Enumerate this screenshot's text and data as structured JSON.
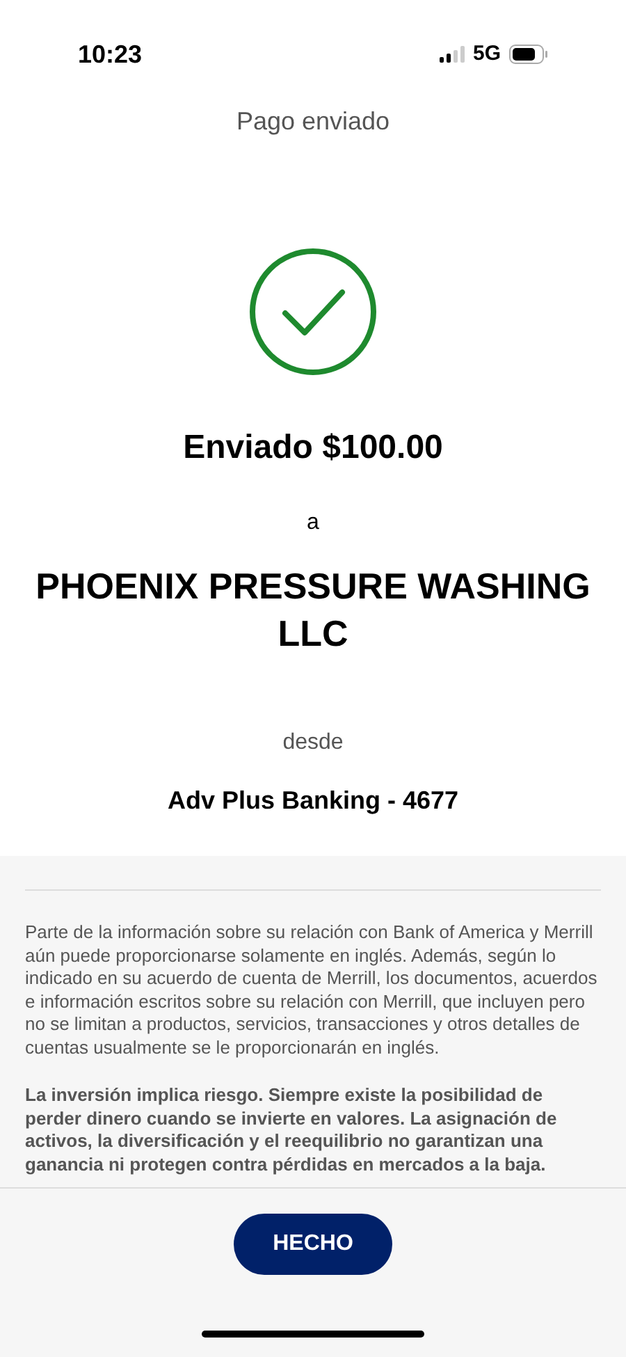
{
  "status_bar": {
    "time": "10:23",
    "network": "5G"
  },
  "header": {
    "title": "Pago enviado"
  },
  "confirmation": {
    "amount_line": "Enviado $100.00",
    "to_label": "a",
    "payee": "PHOENIX PRESSURE WASHING LLC",
    "from_label": "desde",
    "account": "Adv Plus Banking - 4677"
  },
  "disclaimer": [
    {
      "text": "Parte de la información sobre su relación con Bank of America y Merrill aún puede proporcionarse solamente en inglés. Además, según lo indicado en su acuerdo de cuenta de Merrill, los documentos, acuerdos e información escritos sobre su relación con Merrill, que incluyen pero no se limitan a productos, servicios, transacciones y otros detalles de cuentas usualmente se le proporcionarán en inglés.",
      "bold": false
    },
    {
      "text": "La inversión implica riesgo. Siempre existe la posibilidad de perder dinero cuando se invierte en valores. La asignación de activos, la diversificación y el reequilibrio no garantizan una ganancia ni protegen contra pérdidas en mercados a la baja.",
      "bold": true
    }
  ],
  "button": {
    "label": "HECHO"
  }
}
